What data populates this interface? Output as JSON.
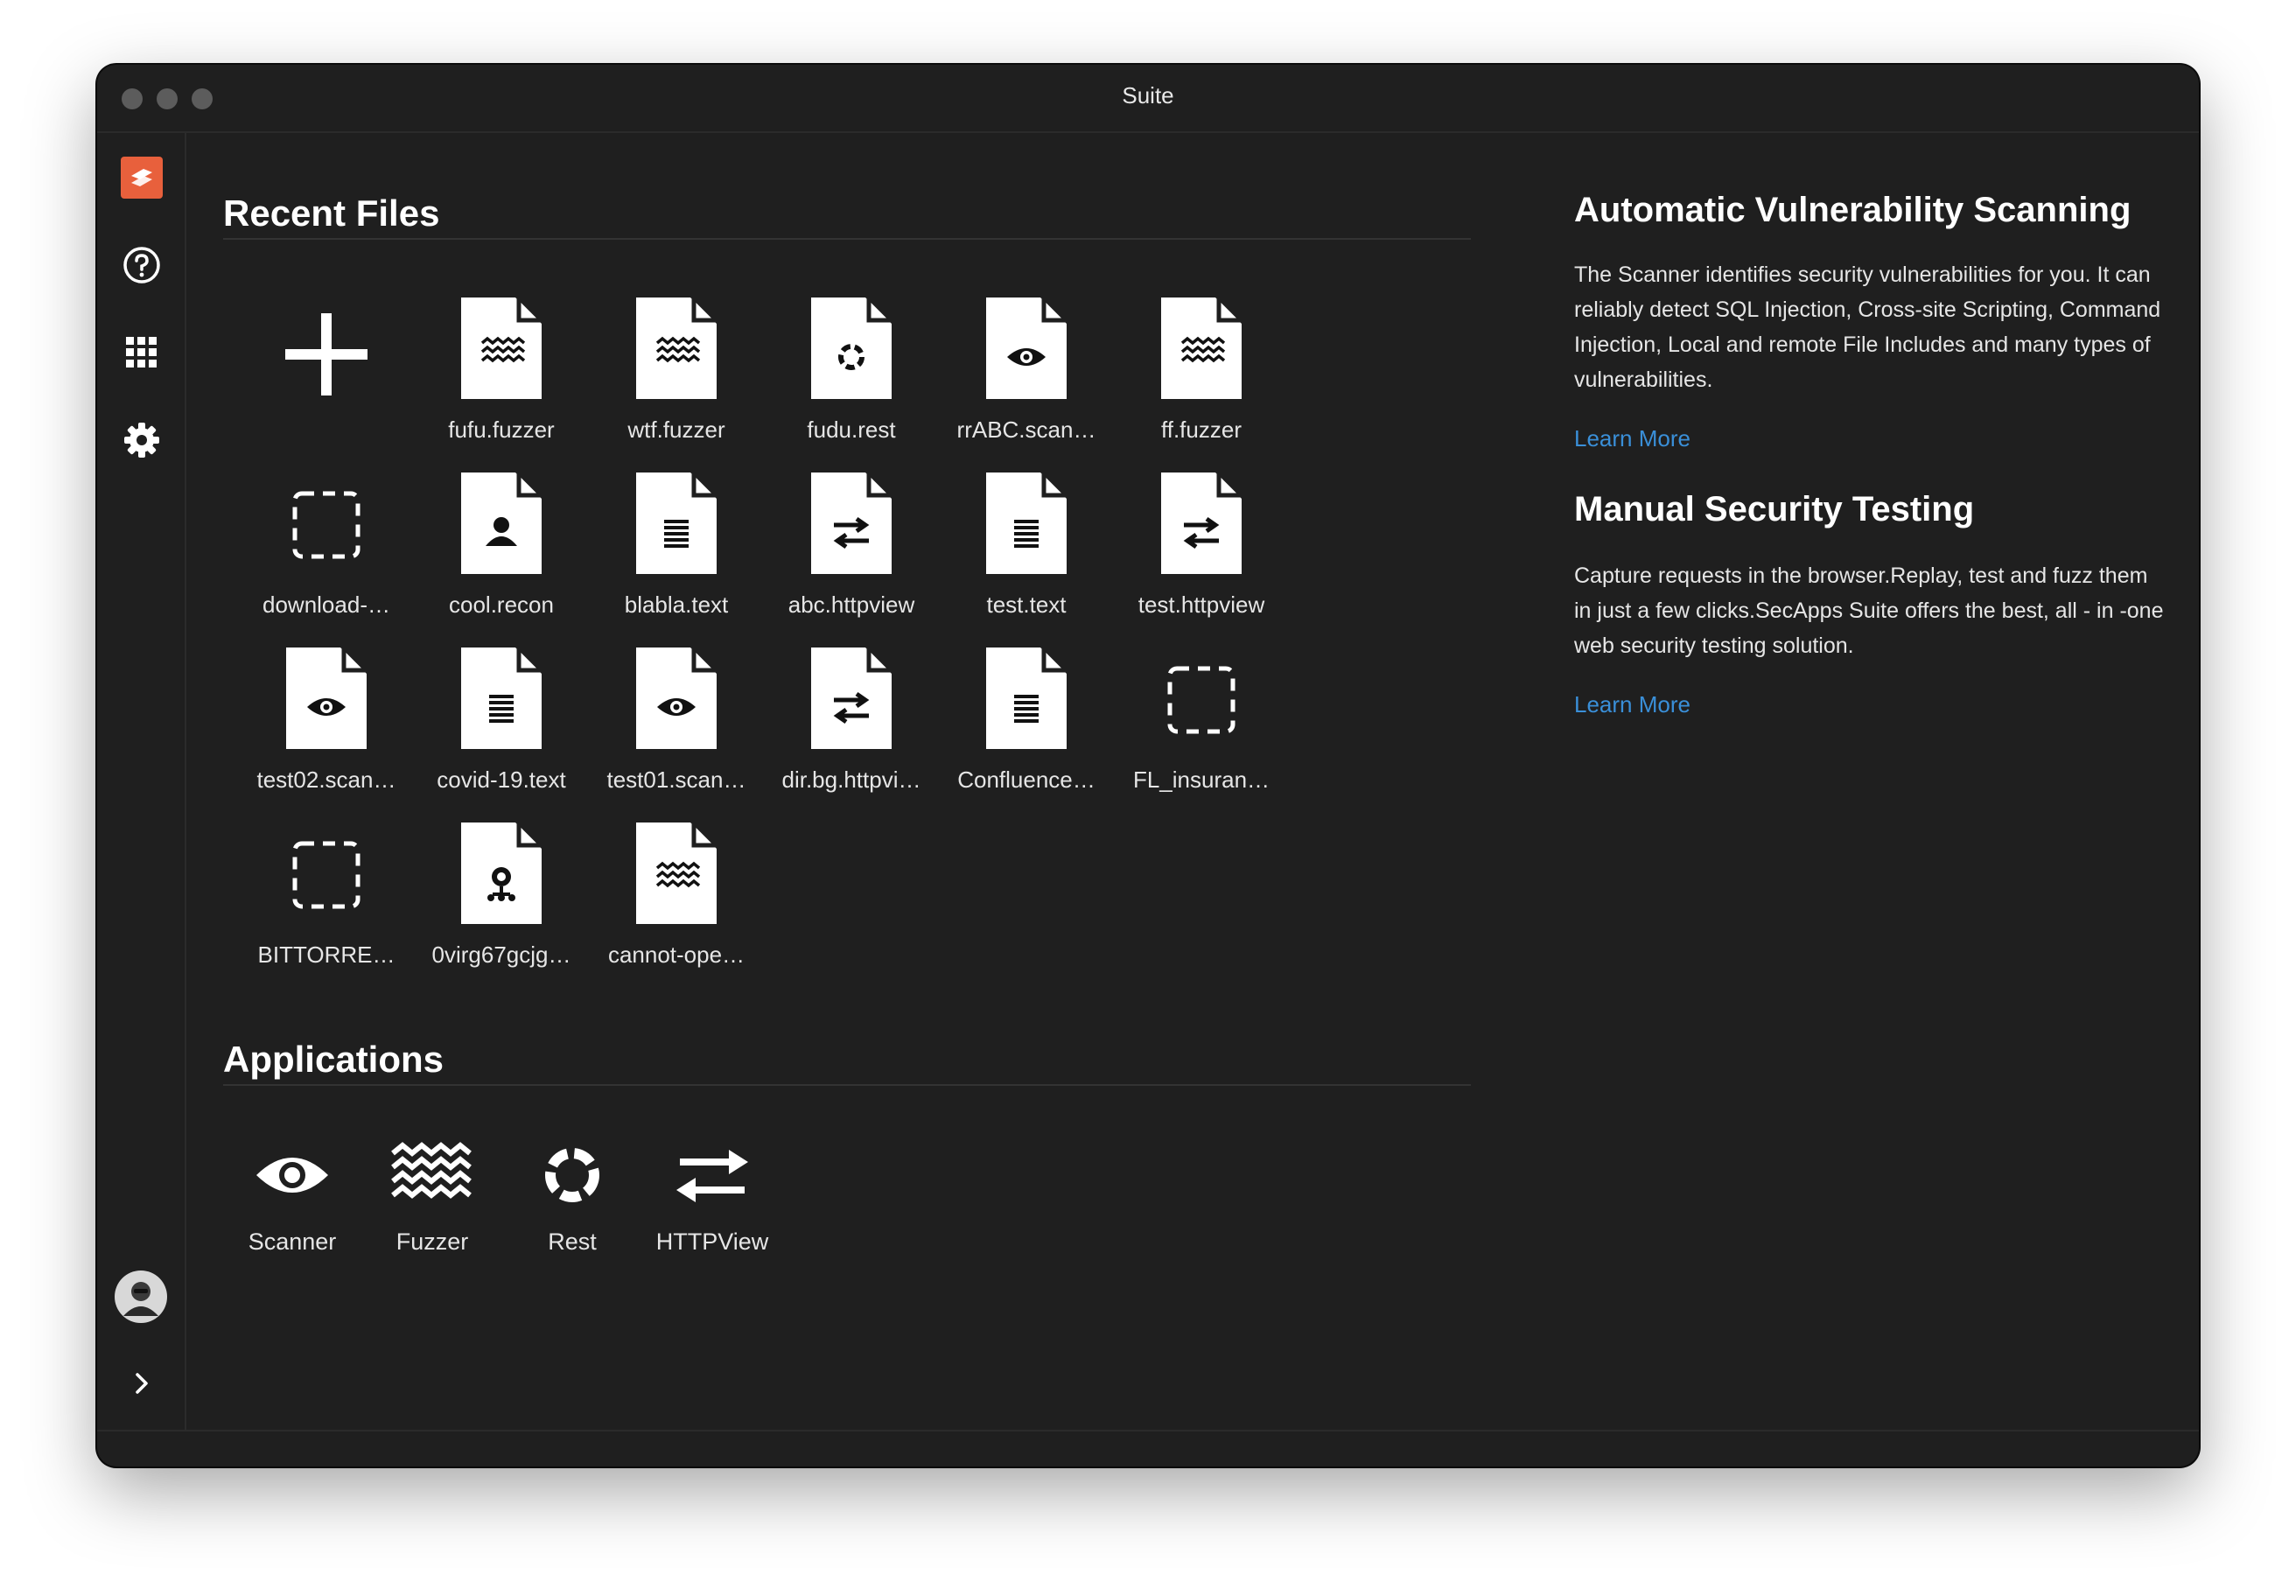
{
  "window": {
    "title": "Suite"
  },
  "sidebar": {
    "items": [
      {
        "name": "logo",
        "icon": "secapps-logo-icon"
      },
      {
        "name": "help",
        "icon": "question-circle-icon"
      },
      {
        "name": "apps",
        "icon": "grid-icon"
      },
      {
        "name": "settings",
        "icon": "gear-icon"
      }
    ],
    "bottom": [
      {
        "name": "avatar",
        "icon": "avatar"
      },
      {
        "name": "expand",
        "icon": "chevron-right-icon"
      }
    ]
  },
  "recent": {
    "title": "Recent Files",
    "new_icon": "plus-icon",
    "files": [
      {
        "label": "fufu.fuzzer",
        "icon": "fuzzer-wave-icon"
      },
      {
        "label": "wtf.fuzzer",
        "icon": "fuzzer-wave-icon"
      },
      {
        "label": "fudu.rest",
        "icon": "rest-ring-icon"
      },
      {
        "label": "rrABC.scan…",
        "icon": "scanner-eye-icon"
      },
      {
        "label": "ff.fuzzer",
        "icon": "fuzzer-wave-icon"
      },
      {
        "label": "download-…",
        "icon": "unknown-dashed-icon"
      },
      {
        "label": "cool.recon",
        "icon": "recon-person-icon"
      },
      {
        "label": "blabla.text",
        "icon": "text-lines-icon"
      },
      {
        "label": "abc.httpview",
        "icon": "httpview-arrows-icon"
      },
      {
        "label": "test.text",
        "icon": "text-lines-icon"
      },
      {
        "label": "test.httpview",
        "icon": "httpview-arrows-icon"
      },
      {
        "label": "test02.scan…",
        "icon": "scanner-eye-icon"
      },
      {
        "label": "covid-19.text",
        "icon": "text-lines-icon"
      },
      {
        "label": "test01.scan…",
        "icon": "scanner-eye-icon"
      },
      {
        "label": "dir.bg.httpvi…",
        "icon": "httpview-arrows-icon"
      },
      {
        "label": "Confluence…",
        "icon": "text-lines-icon"
      },
      {
        "label": "FL_insuran…",
        "icon": "unknown-dashed-icon"
      },
      {
        "label": "BITTORRE…",
        "icon": "unknown-dashed-icon"
      },
      {
        "label": "0virg67gcjg…",
        "icon": "graph-node-icon"
      },
      {
        "label": "cannot-ope…",
        "icon": "fuzzer-wave-icon"
      }
    ]
  },
  "applications": {
    "title": "Applications",
    "items": [
      {
        "label": "Scanner",
        "icon": "eye-icon"
      },
      {
        "label": "Fuzzer",
        "icon": "wave-icon"
      },
      {
        "label": "Rest",
        "icon": "ring-icon"
      },
      {
        "label": "HTTPView",
        "icon": "swap-arrows-icon"
      }
    ]
  },
  "info": [
    {
      "title": "Automatic Vulnerability Scanning",
      "text": "The Scanner identifies security vulnerabilities for you. It can reliably detect SQL Injection, Cross-site Scripting, Command Injection, Local and remote File Includes and many types of vulnerabilities.",
      "link": "Learn More"
    },
    {
      "title": "Manual Security Testing",
      "text": "Capture requests in the browser.Replay, test and fuzz them in just a few clicks.SecApps Suite offers the best, all - in -one web security testing solution.",
      "link": "Learn More"
    }
  ],
  "colors": {
    "background": "#1f1f1f",
    "accent": "#e8603c",
    "link": "#3a8fd8",
    "text": "#ffffff"
  }
}
